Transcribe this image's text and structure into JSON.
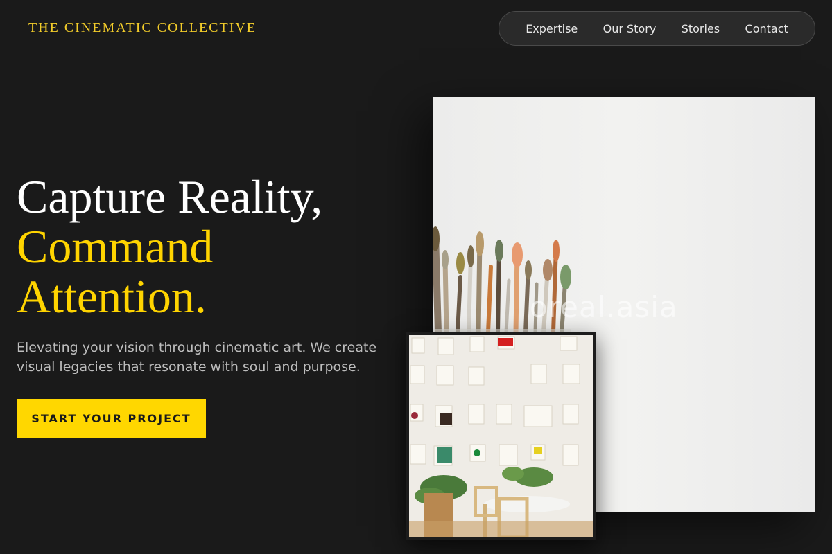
{
  "brand": {
    "logo_text": "THE CINEMATIC COLLECTIVE"
  },
  "nav": {
    "items": [
      {
        "label": "Expertise"
      },
      {
        "label": "Our Story"
      },
      {
        "label": "Stories"
      },
      {
        "label": "Contact"
      }
    ]
  },
  "hero": {
    "headline_line1": "Capture Reality,",
    "headline_line2": "Command",
    "headline_line3": "Attention.",
    "subtitle": "Elevating your vision through cinematic art. We create visual legacies that resonate with soul and purpose.",
    "cta_label": "START YOUR PROJECT",
    "watermark": "oreal.asia"
  },
  "colors": {
    "background": "#1a1a1a",
    "accent": "#ffd700",
    "text": "#ffffff",
    "muted": "#bdbdbd"
  },
  "images": {
    "main": "paint-brushes-photo",
    "secondary": "moodboard-wall-photo"
  }
}
